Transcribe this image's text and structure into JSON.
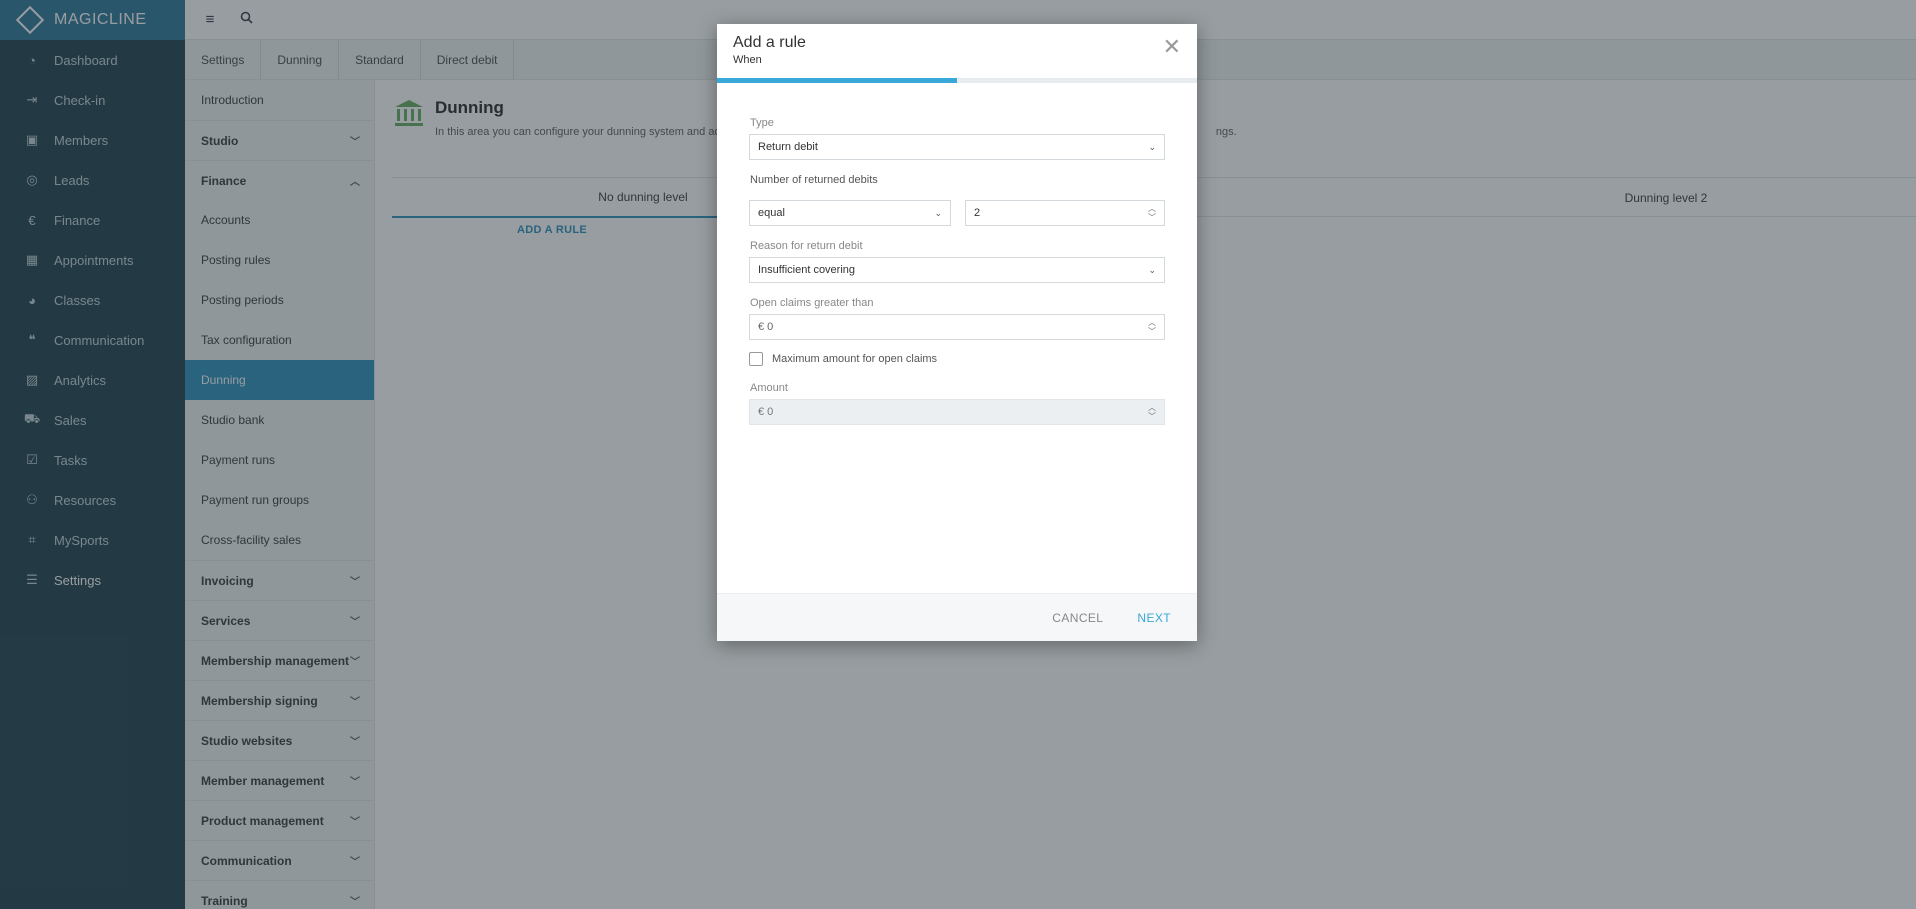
{
  "brand": {
    "name": "MAGICLINE"
  },
  "nav": {
    "items": [
      {
        "label": "Dashboard",
        "icon": "dashboard-icon"
      },
      {
        "label": "Check-in",
        "icon": "checkin-icon"
      },
      {
        "label": "Members",
        "icon": "members-icon"
      },
      {
        "label": "Leads",
        "icon": "leads-icon"
      },
      {
        "label": "Finance",
        "icon": "finance-icon"
      },
      {
        "label": "Appointments",
        "icon": "appointments-icon"
      },
      {
        "label": "Classes",
        "icon": "classes-icon"
      },
      {
        "label": "Communication",
        "icon": "communication-icon"
      },
      {
        "label": "Analytics",
        "icon": "analytics-icon"
      },
      {
        "label": "Sales",
        "icon": "sales-icon"
      },
      {
        "label": "Tasks",
        "icon": "tasks-icon"
      },
      {
        "label": "Resources",
        "icon": "resources-icon"
      },
      {
        "label": "MySports",
        "icon": "mysports-icon"
      },
      {
        "label": "Settings",
        "icon": "settings-icon"
      }
    ]
  },
  "breadcrumb": [
    "Settings",
    "Dunning",
    "Standard",
    "Direct debit"
  ],
  "subnav": {
    "items": [
      {
        "label": "Introduction",
        "group": false
      },
      {
        "label": "Studio",
        "group": true
      },
      {
        "label": "Finance",
        "group": true
      },
      {
        "label": "Accounts",
        "group": false
      },
      {
        "label": "Posting rules",
        "group": false
      },
      {
        "label": "Posting periods",
        "group": false
      },
      {
        "label": "Tax configuration",
        "group": false
      },
      {
        "label": "Dunning",
        "group": false
      },
      {
        "label": "Studio bank",
        "group": false
      },
      {
        "label": "Payment runs",
        "group": false
      },
      {
        "label": "Payment run groups",
        "group": false
      },
      {
        "label": "Cross-facility sales",
        "group": false
      },
      {
        "label": "Invoicing",
        "group": true
      },
      {
        "label": "Services",
        "group": true
      },
      {
        "label": "Membership management",
        "group": true
      },
      {
        "label": "Membership signing",
        "group": true
      },
      {
        "label": "Studio websites",
        "group": true
      },
      {
        "label": "Member management",
        "group": true
      },
      {
        "label": "Product management",
        "group": true
      },
      {
        "label": "Communication",
        "group": true
      },
      {
        "label": "Training",
        "group": true
      }
    ]
  },
  "main": {
    "title": "Dunning",
    "description_left": "In this area you can configure your dunning system and adapt",
    "description_right": "ngs.",
    "level_tabs": [
      "No dunning level",
      "Dunning level 2"
    ],
    "add_rule": "ADD A RULE"
  },
  "modal": {
    "title": "Add a rule",
    "subtitle": "When",
    "progress": 0.5,
    "type": {
      "label": "Type",
      "value": "Return debit"
    },
    "returned": {
      "label": "Number of returned debits",
      "operator": "equal",
      "count": "2"
    },
    "reason": {
      "label": "Reason for return debit",
      "value": "Insufficient covering"
    },
    "open_claims": {
      "label": "Open claims greater than",
      "value": "€ 0"
    },
    "max_checkbox": {
      "label": "Maximum amount for open claims"
    },
    "amount": {
      "label": "Amount",
      "value": "€ 0"
    },
    "cancel": "CANCEL",
    "next": "NEXT"
  },
  "colors": {
    "accent": "#3aa8d8",
    "nav_bg": "#2d4b59",
    "active": "#3a95c2"
  }
}
